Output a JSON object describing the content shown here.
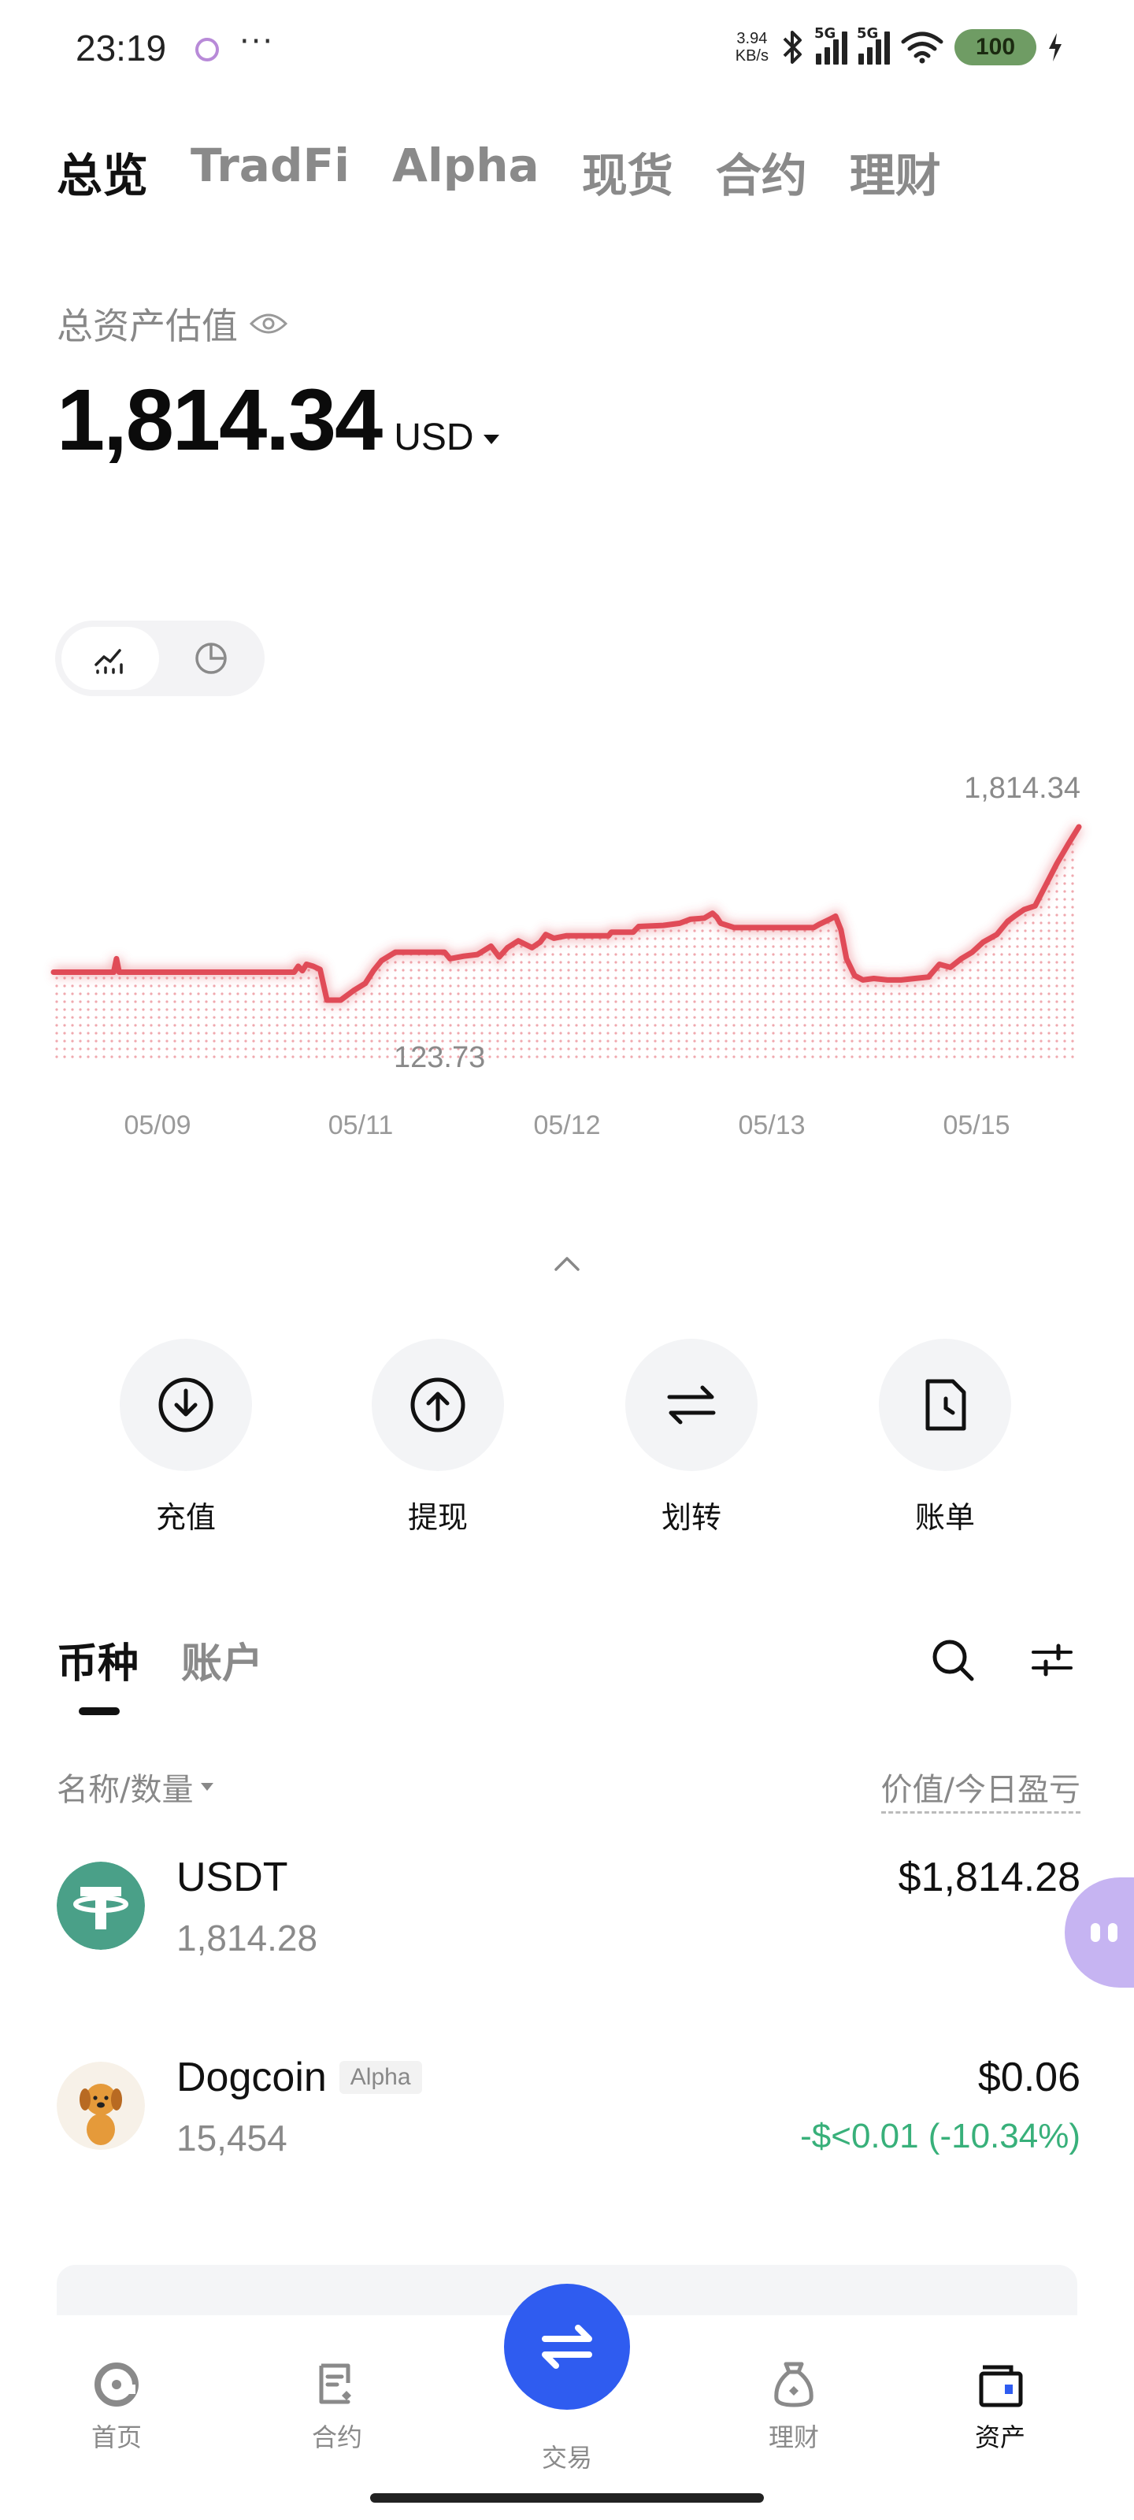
{
  "status_bar": {
    "time": "23:19",
    "more": "···",
    "net_speed_value": "3.94",
    "net_speed_unit": "KB/s",
    "signal1_label": "5G",
    "signal2_label": "5G",
    "battery": "100"
  },
  "top_tabs": [
    "总览",
    "TradFi",
    "Alpha",
    "现货",
    "合约",
    "理财"
  ],
  "assets": {
    "label": "总资产估值",
    "value": "1,814.34",
    "currency": "USD"
  },
  "chart_data": {
    "type": "line",
    "series_color": "#e04b57",
    "max_label": "1,814.34",
    "min_label": "123.73",
    "x_ticks": [
      "05/09",
      "05/11",
      "05/12",
      "05/13",
      "05/15"
    ],
    "points": [
      [
        0,
        123.73
      ],
      [
        3.5,
        123.73
      ],
      [
        4.4,
        123.73
      ],
      [
        4.6,
        190
      ],
      [
        4.8,
        123.73
      ],
      [
        5.2,
        123.73
      ],
      [
        16.4,
        123.73
      ],
      [
        17.6,
        123.73
      ],
      [
        17.9,
        150
      ],
      [
        18.2,
        130
      ],
      [
        18.5,
        160
      ],
      [
        19.0,
        150
      ],
      [
        19.5,
        135
      ],
      [
        20.0,
        60
      ],
      [
        21.0,
        60
      ],
      [
        22.0,
        70
      ],
      [
        22.8,
        85
      ],
      [
        23.4,
        130
      ],
      [
        24.0,
        180
      ],
      [
        25.0,
        230
      ],
      [
        27.0,
        230
      ],
      [
        28.6,
        230
      ],
      [
        29.0,
        190
      ],
      [
        30.0,
        205
      ],
      [
        31.0,
        215
      ],
      [
        32.0,
        270
      ],
      [
        32.6,
        200
      ],
      [
        33.2,
        260
      ],
      [
        34.0,
        310
      ],
      [
        35.0,
        260
      ],
      [
        35.6,
        300
      ],
      [
        36.0,
        360
      ],
      [
        36.6,
        330
      ],
      [
        37.5,
        350
      ],
      [
        38.6,
        350
      ],
      [
        40.6,
        350
      ],
      [
        40.8,
        380
      ],
      [
        42.4,
        380
      ],
      [
        42.8,
        430
      ],
      [
        44.6,
        440
      ],
      [
        45.8,
        460
      ],
      [
        46.6,
        500
      ],
      [
        47.6,
        510
      ],
      [
        48.2,
        560
      ],
      [
        48.5,
        520
      ],
      [
        48.8,
        460
      ],
      [
        49.8,
        420
      ],
      [
        51.0,
        420
      ],
      [
        52.0,
        420
      ],
      [
        53.0,
        420
      ],
      [
        54.0,
        420
      ],
      [
        55.6,
        420
      ],
      [
        56.0,
        450
      ],
      [
        56.8,
        500
      ],
      [
        57.2,
        530
      ],
      [
        57.6,
        400
      ],
      [
        58.0,
        190
      ],
      [
        58.6,
        110
      ],
      [
        59.2,
        95
      ],
      [
        60.0,
        100
      ],
      [
        61.0,
        95
      ],
      [
        62.0,
        95
      ],
      [
        63.0,
        100
      ],
      [
        64.0,
        105
      ],
      [
        64.8,
        160
      ],
      [
        65.6,
        145
      ],
      [
        66.4,
        190
      ],
      [
        67.2,
        230
      ],
      [
        68.0,
        300
      ],
      [
        69.0,
        360
      ],
      [
        69.8,
        480
      ],
      [
        70.4,
        540
      ],
      [
        71.0,
        600
      ],
      [
        71.8,
        640
      ],
      [
        72.6,
        900
      ],
      [
        73.4,
        1200
      ],
      [
        74.2,
        1500
      ],
      [
        75.0,
        1814.34
      ]
    ]
  },
  "actions": [
    {
      "label": "充值",
      "icon": "deposit-icon"
    },
    {
      "label": "提现",
      "icon": "withdraw-icon"
    },
    {
      "label": "划转",
      "icon": "transfer-icon"
    },
    {
      "label": "账单",
      "icon": "bill-icon"
    }
  ],
  "coin_tabs": [
    "币种",
    "账户"
  ],
  "list_header": {
    "left": "名称/数量",
    "right": "价值/今日盈亏"
  },
  "coins": [
    {
      "name": "USDT",
      "tag": "",
      "qty": "1,814.28",
      "value": "$1,814.28",
      "pnl": "",
      "logo_color": "#4aa088"
    },
    {
      "name": "Dogcoin",
      "tag": "Alpha",
      "qty": "15,454",
      "value": "$0.06",
      "pnl": "-$<0.01 (-10.34%)",
      "logo_color": "#e59a3a"
    }
  ],
  "bottom_nav": {
    "items": [
      {
        "label": "首页",
        "icon": "home-icon"
      },
      {
        "label": "合约",
        "icon": "contract-icon"
      },
      {
        "label": "交易",
        "icon": "trade-icon"
      },
      {
        "label": "理财",
        "icon": "finance-icon"
      },
      {
        "label": "资产",
        "icon": "wallet-icon"
      }
    ],
    "active": "资产",
    "trade_button_color": "#2f5cf0"
  }
}
